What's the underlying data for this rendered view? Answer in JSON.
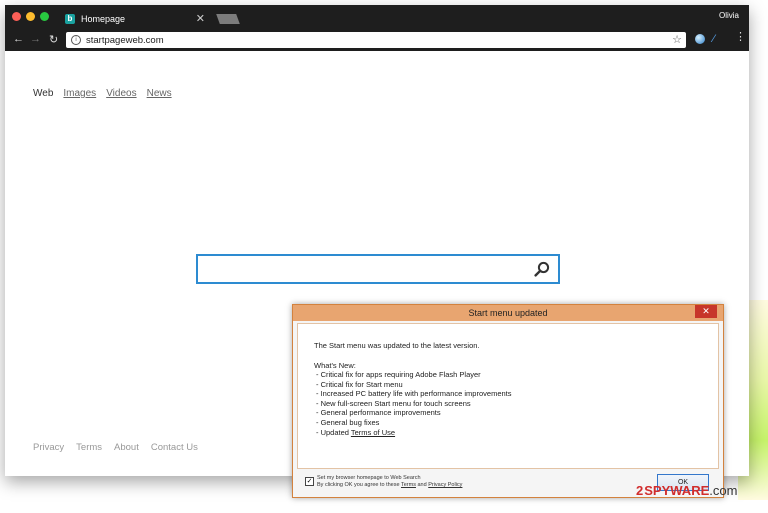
{
  "browser": {
    "tab_title": "Homepage",
    "tab_favicon_letter": "b",
    "tab_close": "✕",
    "profile_name": "Olivia",
    "url": "startpageweb.com",
    "icons": [
      "back-arrow-icon",
      "forward-arrow-icon",
      "reload-icon",
      "info-icon",
      "star-icon",
      "extension-globe-icon",
      "extension-pen-icon",
      "menu-dots-icon"
    ]
  },
  "page": {
    "nav_links": [
      "Web",
      "Images",
      "Videos",
      "News"
    ],
    "footer_links": [
      "Privacy",
      "Terms",
      "About",
      "Contact Us"
    ]
  },
  "dialog": {
    "title": "Start menu updated",
    "close_label": "✕",
    "message": "The Start menu was updated to the latest version.",
    "whats_new_label": "What's New:",
    "changes": [
      "- Critical fix for apps requiring Adobe Flash Player",
      "- Critical fix for Start menu",
      "- Increased PC battery life with performance improvements",
      "- New full-screen Start menu for touch screens",
      "- General performance improvements",
      "- General bug fixes"
    ],
    "last_change_prefix": "- Updated ",
    "last_change_link": "Terms of Use",
    "consent_line1": "Set my browser homepage to Web Search",
    "consent_line2_prefix": "By clicking OK you agree to these ",
    "consent_terms_link": "Terms",
    "consent_and": " and ",
    "consent_privacy_link": "Privacy Policy",
    "consent_checked": true,
    "ok_label": "OK"
  },
  "watermark": {
    "digit": "2",
    "brand": "SPYWARE",
    "domain": ".com"
  }
}
